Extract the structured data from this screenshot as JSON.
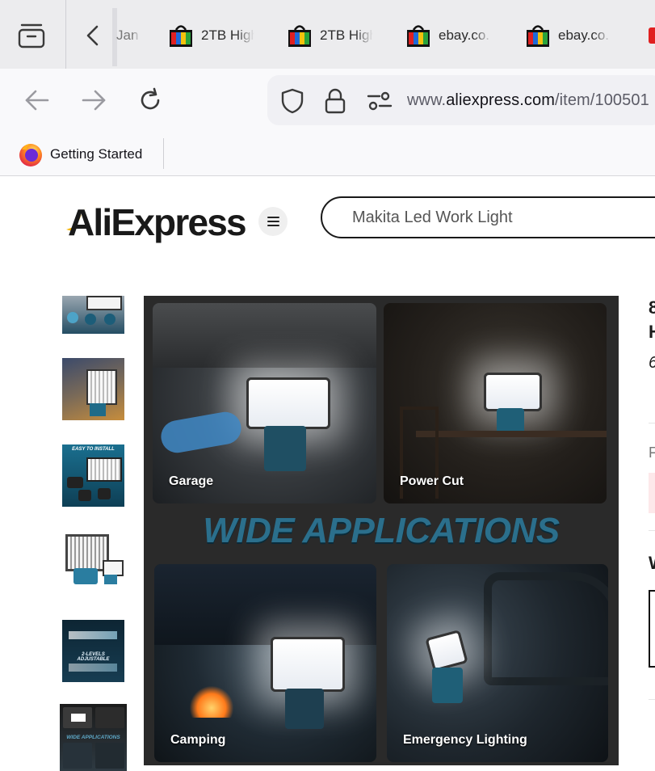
{
  "tabs": [
    {
      "label": "Jan",
      "favicon": "jan-icon"
    },
    {
      "label": "2TB High",
      "favicon": "shopping-bag-icon"
    },
    {
      "label": "2TB High",
      "favicon": "shopping-bag-icon"
    },
    {
      "label": "ebay.co.",
      "favicon": "shopping-bag-icon"
    },
    {
      "label": "ebay.co.",
      "favicon": "shopping-bag-icon"
    }
  ],
  "url": {
    "prefix": "www.",
    "host": "aliexpress.com",
    "path": "/item/100501"
  },
  "bookmarks": [
    {
      "label": "Getting Started",
      "icon": "firefox-icon"
    }
  ],
  "site": {
    "logo": "AliExpress",
    "search_value": "Makita Led Work Light"
  },
  "product": {
    "thumbnail_captions": [
      "",
      "",
      "EASY TO INSTALL",
      "",
      "2-LEVELS ADJUSTABLE",
      "WIDE APPLICATIONS"
    ],
    "main_image": {
      "title": "WIDE APPLICATIONS",
      "panels": [
        "Garage",
        "Power Cut",
        "Camping",
        "Emergency Lighting"
      ]
    },
    "right_fragments": [
      "8",
      "H",
      "6",
      "F",
      "W"
    ]
  },
  "colors": {
    "accent": "#2b6f8c",
    "brand_yellow": "#f5b400",
    "chrome": "#ececee"
  }
}
